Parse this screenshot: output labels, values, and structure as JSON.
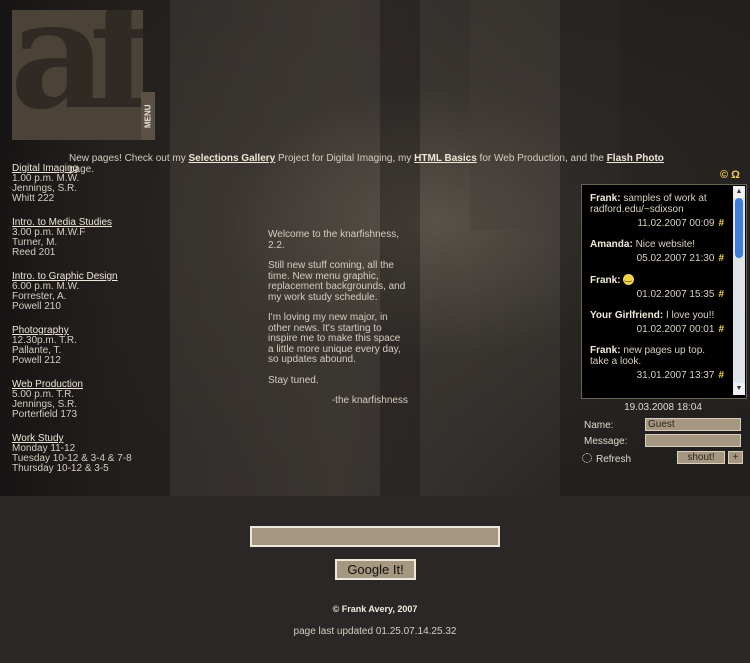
{
  "logo": {
    "glyph": "af",
    "menu_label": "MENU"
  },
  "announcement": {
    "prefix": "New pages! Check out my ",
    "link1": "Selections Gallery",
    "mid1": " Project for Digital Imaging, my ",
    "link2": "HTML Basics",
    "mid2": " for Web Production, and the ",
    "link3": "Flash Photo",
    "suffix": " page."
  },
  "schedule": [
    {
      "title": "Digital Imaging",
      "lines": [
        "1.00 p.m. M.W.",
        "Jennings, S.R.",
        "Whitt 222"
      ]
    },
    {
      "title": "Intro. to Media Studies",
      "lines": [
        "3.00 p.m. M.W.F",
        "Turner, M.",
        "Reed 201"
      ]
    },
    {
      "title": "Intro. to Graphic Design",
      "lines": [
        "6.00 p.m. M.W.",
        "Forrester, A.",
        "Powell 210"
      ]
    },
    {
      "title": "Photography",
      "lines": [
        "12.30p.m. T.R.",
        "Pallante, T.",
        "Powell 212"
      ]
    },
    {
      "title": "Web Production",
      "lines": [
        "5.00 p.m. T.R.",
        "Jennings, S.R.",
        "Porterfield 173"
      ]
    },
    {
      "title": "Work Study",
      "lines": [
        "Monday 11-12",
        "Tuesday 10-12 & 3-4 & 7-8",
        "Thursday 10-12 & 3-5"
      ]
    }
  ],
  "welcome": {
    "p1": "Welcome to the knarfishness, 2.2.",
    "p2": "Still new stuff coming, all the time. New menu graphic, replacement backgrounds, and my work study schedule.",
    "p3": "I'm loving my new major, in other news. It's starting to inspire me to make this space a little more unique every day, so updates abound.",
    "p4": "Stay tuned.",
    "signature": "-the knarfishness"
  },
  "shoutbox": {
    "top_icons": "© Ω",
    "messages": [
      {
        "name": "Frank:",
        "text": "samples of work at radford.edu/~sdixson",
        "date": "11.02.2007 00:09"
      },
      {
        "name": "Amanda:",
        "text": "Nice website!",
        "date": "05.02.2007 21:30"
      },
      {
        "name": "Frank:",
        "text": "",
        "date": "01.02.2007 15:35"
      },
      {
        "name": "Your Girlfriend:",
        "text": "I love you!!",
        "date": "01.02.2007 00:01"
      },
      {
        "name": "Frank:",
        "text": "new pages up top. take a look.",
        "date": "31.01.2007 13:37"
      }
    ],
    "hash": "#",
    "current_time": "19.03.2008 18:04",
    "name_label": "Name:",
    "name_value": "Guest",
    "message_label": "Message:",
    "refresh_label": "Refresh",
    "shout_label": "shout!",
    "plus_label": "+"
  },
  "search": {
    "button_label": "Google It!"
  },
  "footer": {
    "copyright": "© Frank Avery, 2007",
    "updated": "page last updated 01.25.07.14.25.32"
  }
}
